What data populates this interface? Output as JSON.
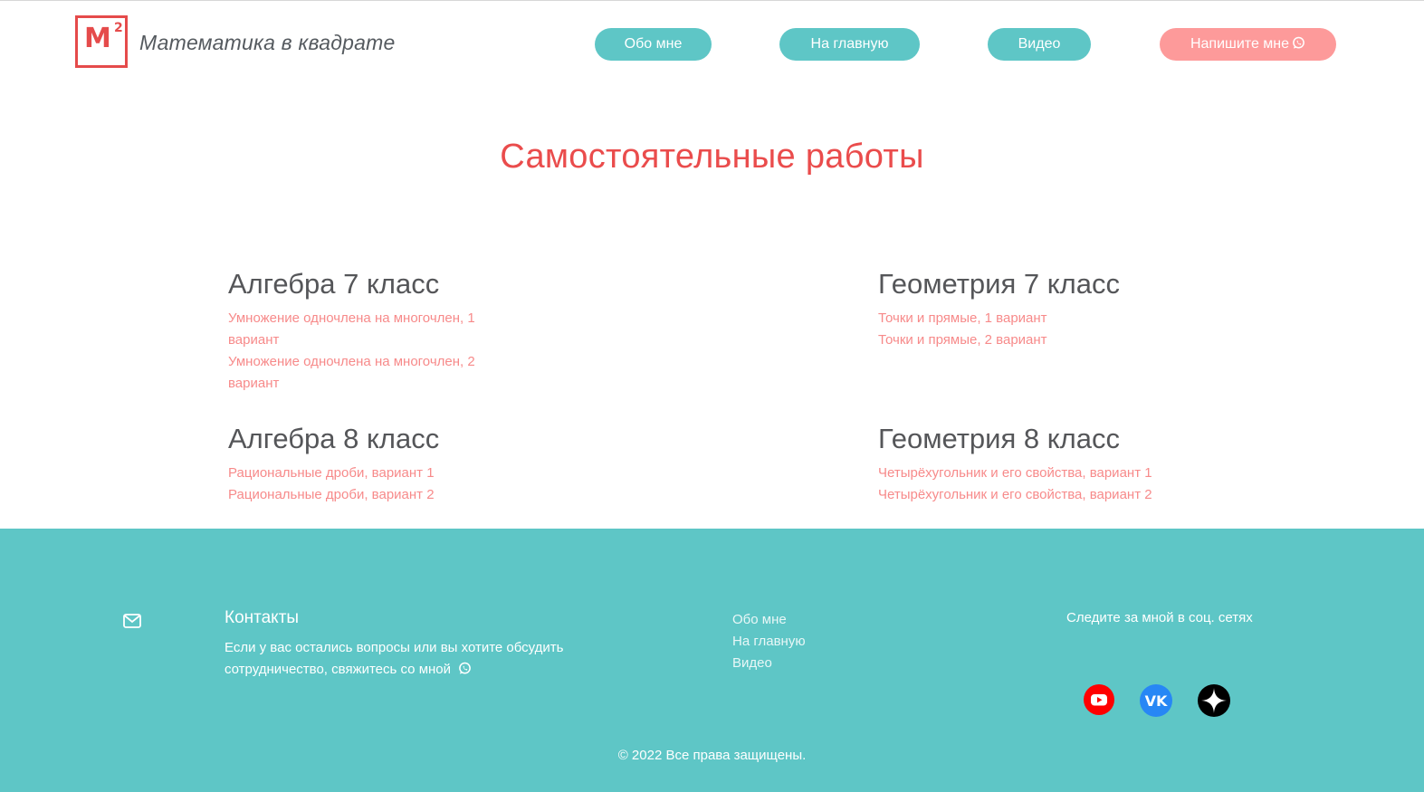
{
  "header": {
    "logo_letter": "M",
    "logo_superscript": "2",
    "brand": "Математика в квадрате",
    "nav": [
      {
        "label": "Обо мне"
      },
      {
        "label": "На главную"
      },
      {
        "label": "Видео"
      }
    ],
    "write_me": "Напишите мне"
  },
  "main": {
    "title": "Самостоятельные работы",
    "sections": [
      {
        "title": "Алгебра 7 класс",
        "links": [
          "Умножение одночлена на многочлен, 1 вариант",
          "Умножение одночлена на многочлен, 2 вариант"
        ]
      },
      {
        "title": "Геометрия 7 класс",
        "links": [
          "Точки и прямые, 1 вариант",
          "Точки и прямые, 2 вариант"
        ]
      },
      {
        "title": "Алгебра 8 класс",
        "links": [
          "Рациональные дроби, вариант 1",
          "Рациональные дроби, вариант 2"
        ]
      },
      {
        "title": "Геометрия 8 класс",
        "links": [
          "Четырёхугольник и его свойства, вариант 1",
          "Четырёхугольник и его свойства, вариант 2"
        ]
      }
    ]
  },
  "footer": {
    "contacts_title": "Контакты",
    "contacts_text": "Если у вас остались вопросы или вы хотите обсудить сотрудничество, свяжитесь со мной",
    "links": [
      "Обо мне",
      "На главную",
      "Видео"
    ],
    "social_title": "Следите за мной в соц. сетях",
    "social": [
      {
        "icon": "youtube-icon",
        "color": "#ff0000"
      },
      {
        "icon": "vk-icon",
        "color": "#2787f5"
      },
      {
        "icon": "dzen-icon",
        "color": "#000000"
      }
    ],
    "copyright": "© 2022 Все права защищены."
  },
  "colors": {
    "accent_teal": "#5ec6c6",
    "accent_pink": "#fd9a9a",
    "title_red": "#ea4c4c",
    "link_pink": "#f78a8a"
  }
}
